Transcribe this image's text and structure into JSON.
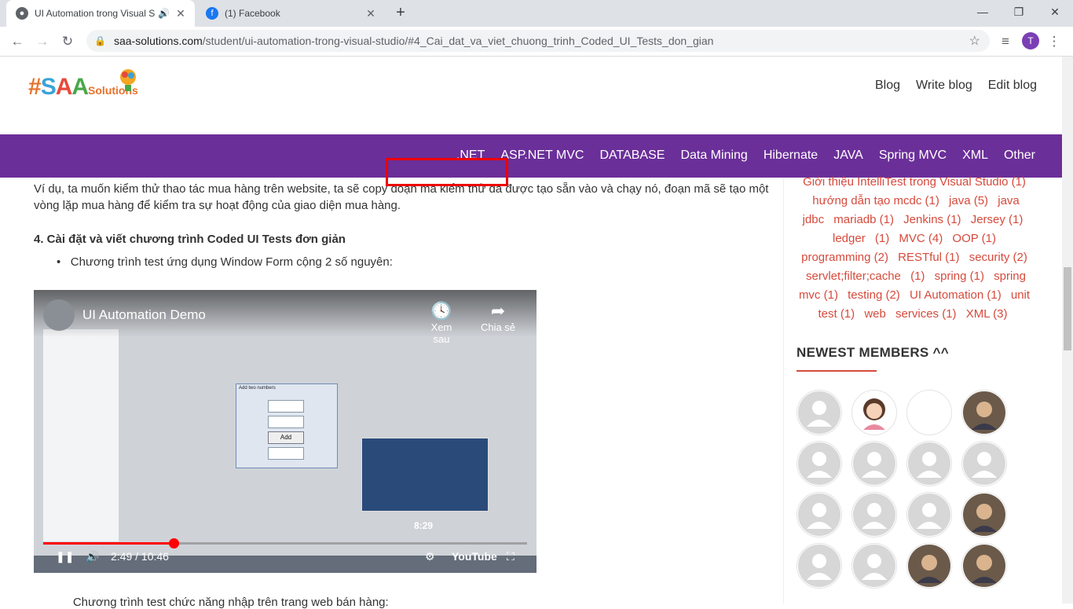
{
  "browser": {
    "tabs": [
      {
        "title": "UI Automation trong Visual S",
        "active": true
      },
      {
        "title": "(1) Facebook",
        "active": false
      }
    ],
    "new_tab": "+",
    "url_domain": "saa-solutions.com",
    "url_path": "/student/ui-automation-trong-visual-studio/#4_Cai_dat_va_viet_chuong_trinh_Coded_UI_Tests_don_gian",
    "profile_initial": "T"
  },
  "site": {
    "logo_hash": "#",
    "logo_s": "S",
    "logo_a1": "A",
    "logo_a2": "A",
    "logo_solutions": "Solutions",
    "top_menu": [
      "Blog",
      "Write blog",
      "Edit blog"
    ],
    "category_menu": [
      ".NET",
      "ASP.NET MVC",
      "DATABASE",
      "Data Mining",
      "Hibernate",
      "JAVA",
      "Spring MVC",
      "XML",
      "Other"
    ]
  },
  "article": {
    "paragraph": "Ví dụ, ta muốn kiểm thử thao tác mua hàng trên website, ta sẽ copy đoạn mã kiểm thử đã được tạo sẵn vào và chạy nó, đoạn mã sẽ tạo một vòng lặp mua hàng để kiểm tra sự hoạt động của giao diện mua hàng.",
    "heading": "4. Cài đặt và viết chương trình Coded UI Tests đơn giản",
    "bullet1": "Chương trình test ứng dụng Window Form cộng 2 số nguyên:",
    "bullet2": "Chương trình test chức năng nhập trên trang web bán hàng:"
  },
  "video": {
    "title": "UI Automation Demo",
    "watch_later": "Xem sau",
    "share": "Chia sẻ",
    "dialog_title": "Add two numbers",
    "add_button": "Add",
    "preview_time": "8:29",
    "time": "2:49 / 10:46",
    "youtube": "YouTube",
    "progress": 0.27
  },
  "sidebar": {
    "tags": [
      "Giới thiệu IntelliTest trong Visual Studio (1)",
      "hướng dẫn tạo mcdc (1)",
      "java (5)",
      "java jdbc",
      "mariadb (1)",
      "Jenkins (1)",
      "Jersey (1)",
      "ledger",
      "(1)",
      "MVC (4)",
      "OOP (1)",
      "programming (2)",
      "RESTful (1)",
      "security (2)",
      "servlet;filter;cache",
      "(1)",
      "spring (1)",
      "spring mvc (1)",
      "testing (2)",
      "UI Automation (1)",
      "unit test (1)",
      "web",
      "services (1)",
      "XML (3)"
    ],
    "newest_members_title": "NEWEST MEMBERS ^^",
    "members": [
      "default",
      "female",
      "blank",
      "photo",
      "default",
      "default",
      "default",
      "default",
      "default",
      "default",
      "default",
      "photo",
      "default",
      "default",
      "photo",
      "photo"
    ]
  },
  "colors": {
    "purple": "#6b2f99",
    "tag_red": "#d64a3c"
  }
}
